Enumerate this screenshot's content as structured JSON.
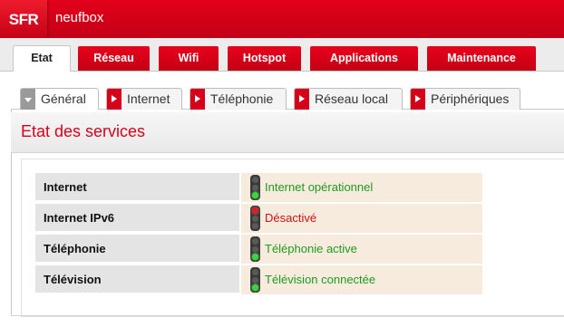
{
  "header": {
    "logo_text": "SFR",
    "product_name": "neufbox"
  },
  "nav": {
    "tabs": [
      {
        "label": "Etat",
        "active": true
      },
      {
        "label": "Réseau",
        "active": false
      },
      {
        "label": "Wifi",
        "active": false
      },
      {
        "label": "Hotspot",
        "active": false
      },
      {
        "label": "Applications",
        "active": false
      },
      {
        "label": "Maintenance",
        "active": false
      }
    ]
  },
  "subnav": {
    "tabs": [
      {
        "label": "Général",
        "active": true
      },
      {
        "label": "Internet",
        "active": false
      },
      {
        "label": "Téléphonie",
        "active": false
      },
      {
        "label": "Réseau local",
        "active": false
      },
      {
        "label": "Périphériques",
        "active": false
      }
    ]
  },
  "section": {
    "title": "Etat des services"
  },
  "services": [
    {
      "name": "Internet",
      "status": "Internet opérationnel",
      "light": "green"
    },
    {
      "name": "Internet IPv6",
      "status": "Désactivé",
      "light": "red"
    },
    {
      "name": "Téléphonie",
      "status": "Téléphonie active",
      "light": "green"
    },
    {
      "name": "Télévision",
      "status": "Télévision connectée",
      "light": "green"
    }
  ],
  "colors": {
    "brand_red": "#d6001a",
    "status_ok": "#1f9a1f",
    "status_off": "#d11010",
    "value_bg": "#f7ebde"
  }
}
